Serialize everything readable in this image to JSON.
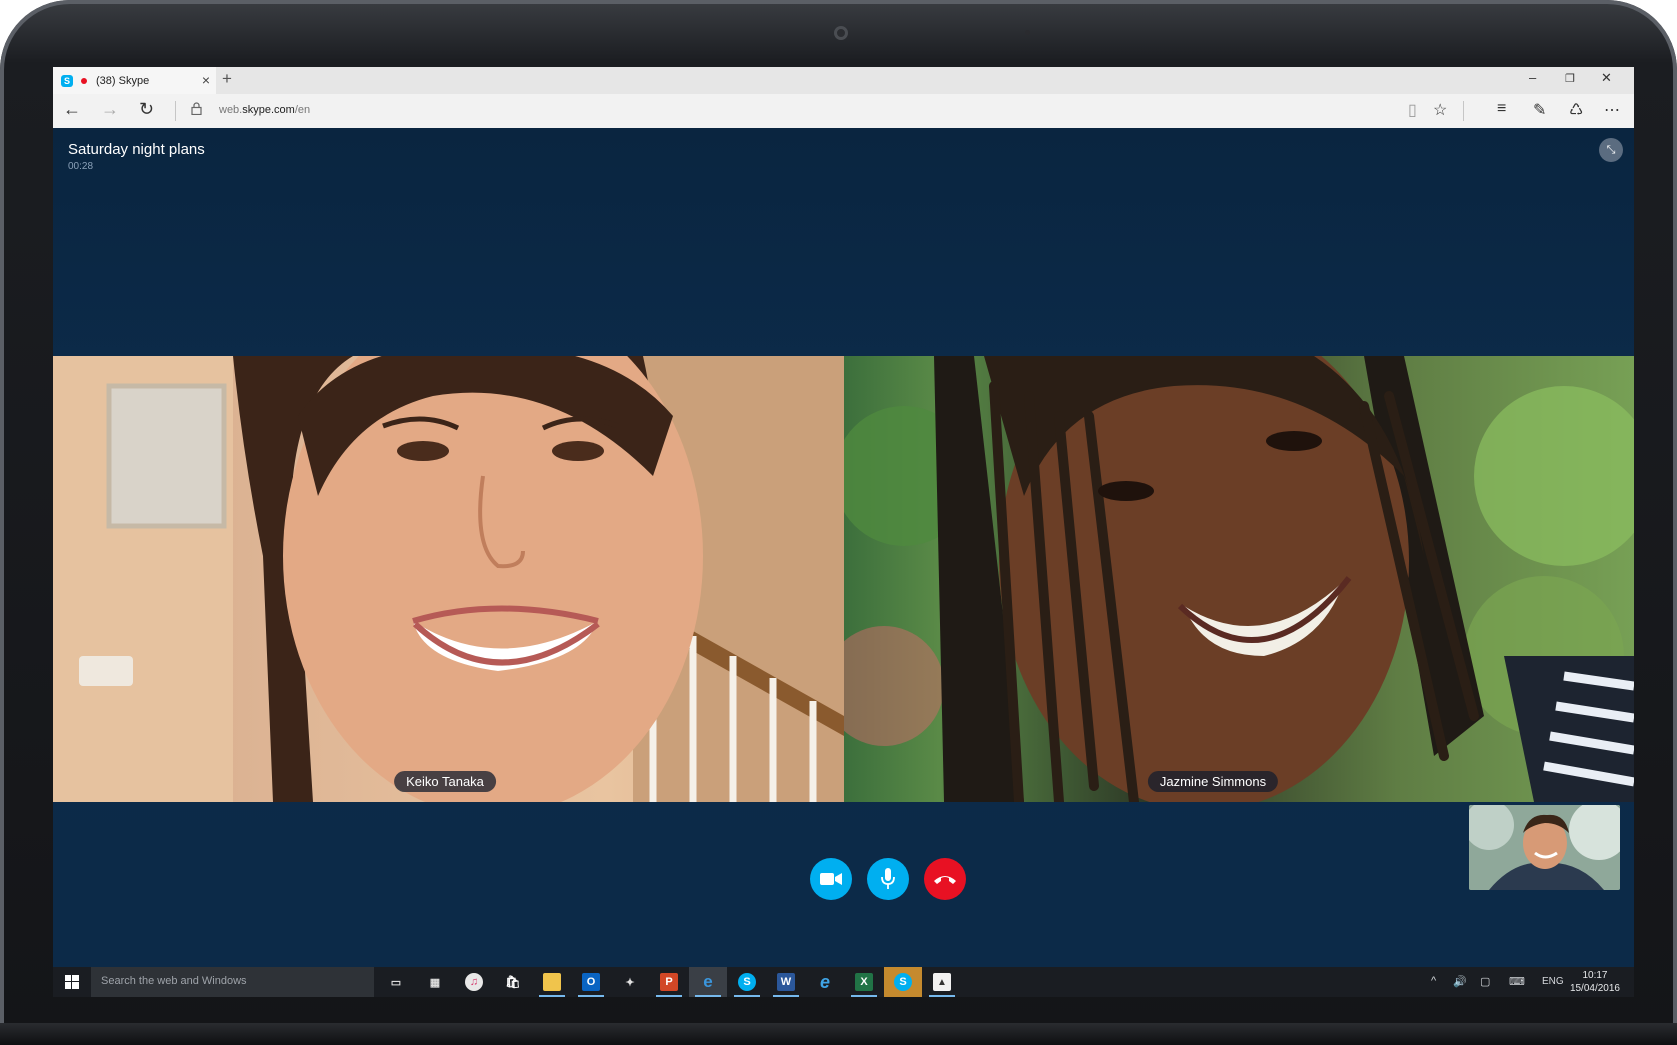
{
  "browser": {
    "tab_title": "(38) Skype",
    "tab_close": "×",
    "new_tab": "+",
    "url_prefix": "web.",
    "url_domain": "skype.com",
    "url_path": "/en",
    "window_controls": {
      "minimize": "–",
      "restore": "❐",
      "close": "✕"
    },
    "nav": {
      "back": "←",
      "forward": "→",
      "refresh": "↻"
    },
    "toolbar_icons": [
      "reading-view-icon",
      "favorites-star-icon",
      "hub-icon",
      "web-note-icon",
      "share-icon",
      "more-icon"
    ],
    "toolbar_glyphs": {
      "reading": "▯",
      "star": "☆",
      "hub": "≡",
      "note": "✎",
      "share": "♺",
      "more": "⋯"
    }
  },
  "call": {
    "title": "Saturday night plans",
    "timer": "00:28",
    "minimize_glyph": "⤡",
    "participants": [
      {
        "name": "Keiko Tanaka"
      },
      {
        "name": "Jazmine Simmons"
      }
    ],
    "controls": {
      "video_color": "#00aff0",
      "mic_color": "#00aff0",
      "end_color": "#e81123"
    }
  },
  "taskbar": {
    "search_placeholder": "Search the web and Windows",
    "apps": [
      {
        "name": "task-view-icon",
        "glyph": "▭"
      },
      {
        "name": "calculator-icon",
        "glyph": "▦"
      },
      {
        "name": "music-icon",
        "glyph": "♫"
      },
      {
        "name": "store-icon",
        "glyph": "🛍"
      },
      {
        "name": "file-explorer-icon",
        "glyph": "▬"
      },
      {
        "name": "outlook-icon",
        "glyph": "O"
      },
      {
        "name": "paint-icon",
        "glyph": "✦"
      },
      {
        "name": "powerpoint-icon",
        "glyph": "P"
      },
      {
        "name": "edge-icon",
        "glyph": "e"
      },
      {
        "name": "skype-preview-icon",
        "glyph": "S"
      },
      {
        "name": "word-icon",
        "glyph": "W"
      },
      {
        "name": "internet-explorer-icon",
        "glyph": "e"
      },
      {
        "name": "excel-icon",
        "glyph": "X"
      },
      {
        "name": "skype-icon",
        "glyph": "S"
      },
      {
        "name": "photos-icon",
        "glyph": "▲"
      }
    ],
    "tray": {
      "chevron": "^",
      "volume": "🔊",
      "action_center": "▢",
      "keyboard": "⌨",
      "language": "ENG",
      "time": "10:17",
      "date": "15/04/2016"
    }
  }
}
